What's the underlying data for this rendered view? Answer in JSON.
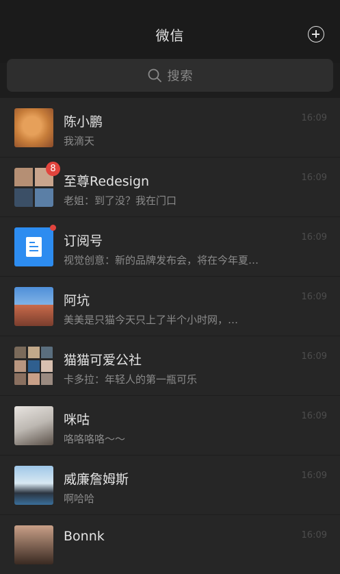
{
  "header": {
    "title": "微信",
    "add_icon": "plus-circle-icon"
  },
  "search": {
    "placeholder": "搜索",
    "icon": "search-icon"
  },
  "chats": [
    {
      "name": "陈小鹏",
      "preview": "我滴天",
      "time": "16:09"
    },
    {
      "name": "至尊Redesign",
      "preview": "老姐：到了没？我在门口",
      "time": "16:09",
      "badge": "8"
    },
    {
      "name": "订阅号",
      "preview": "视觉创意：新的品牌发布会，将在今年夏…",
      "time": "16:09",
      "dot": true,
      "icon": "document-icon"
    },
    {
      "name": "阿坑",
      "preview": "美美是只猫今天只上了半个小时网，…",
      "time": "16:09"
    },
    {
      "name": "猫猫可爱公社",
      "preview": "卡多拉：年轻人的第一瓶可乐",
      "time": "16:09"
    },
    {
      "name": "咪咕",
      "preview": "咯咯咯咯～～",
      "time": "16:09"
    },
    {
      "name": "威廉詹姆斯",
      "preview": "啊哈哈",
      "time": "16:09"
    },
    {
      "name": "Bonnk",
      "preview": "",
      "time": "16:09"
    }
  ],
  "colors": {
    "badge": "#e2443d",
    "subscription_blue": "#2d8cf0",
    "background": "#1d1d1d",
    "row": "#262626"
  }
}
